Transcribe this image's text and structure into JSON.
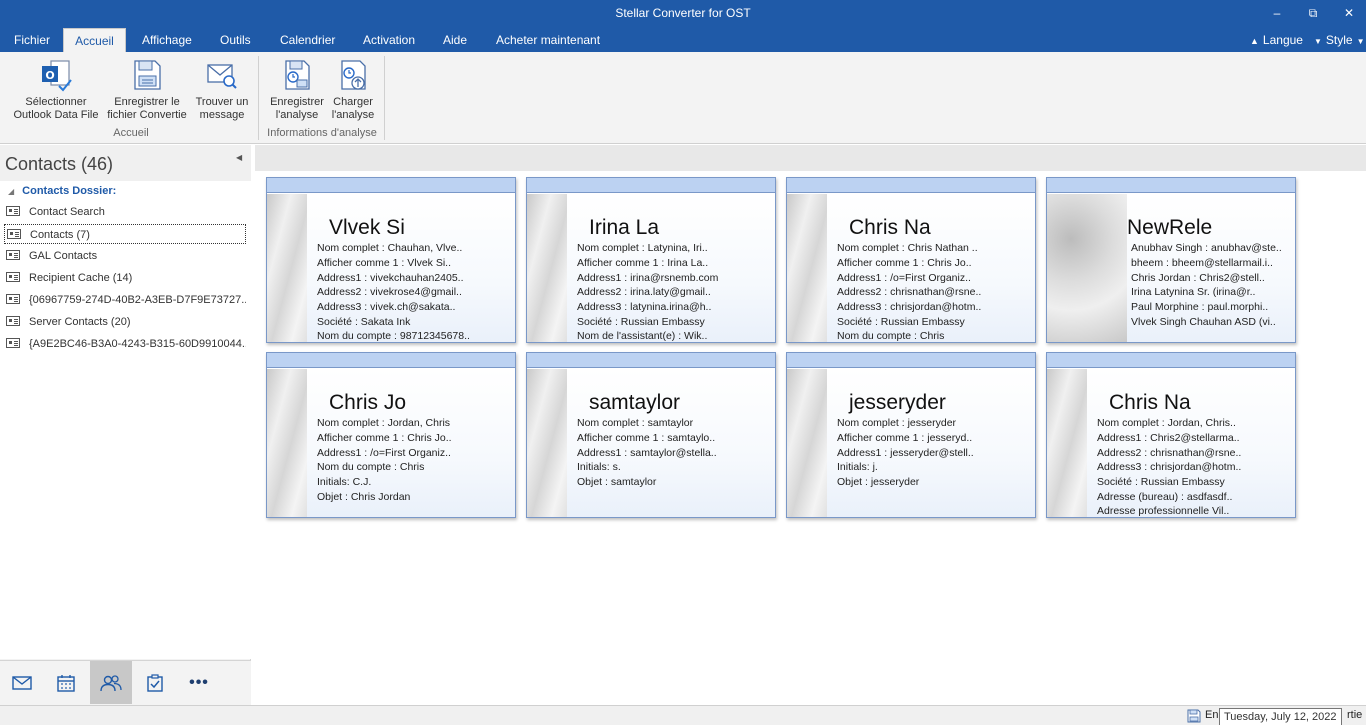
{
  "window": {
    "title": "Stellar Converter for OST",
    "minimize_glyph": "‒",
    "restore_glyph": "⧉",
    "close_glyph": "✕"
  },
  "menu": {
    "items": [
      "Fichier",
      "Accueil",
      "Affichage",
      "Outils",
      "Calendrier",
      "Activation",
      "Aide",
      "Acheter maintenant"
    ],
    "active": "Accueil",
    "langue": "Langue",
    "style": "Style"
  },
  "ribbon": {
    "buttons": [
      {
        "line1": "Sélectionner",
        "line2": "Outlook Data File",
        "icon": "outlook-file-icon"
      },
      {
        "line1": "Enregistrer le",
        "line2": "fichier Convertie",
        "icon": "save-file-icon"
      },
      {
        "line1": "Trouver un",
        "line2": "message",
        "icon": "find-message-icon"
      },
      {
        "line1": "Enregistrer",
        "line2": "l'analyse",
        "icon": "save-scan-icon"
      },
      {
        "line1": "Charger",
        "line2": "l'analyse",
        "icon": "load-scan-icon"
      }
    ],
    "groups": [
      "Accueil",
      "Informations d'analyse"
    ]
  },
  "leftpane": {
    "title": "Contacts (46)",
    "root": "Contacts Dossier:",
    "items": [
      {
        "label": "Contact Search"
      },
      {
        "label": "Contacts (7)"
      },
      {
        "label": "GAL Contacts"
      },
      {
        "label": "Recipient Cache (14)"
      },
      {
        "label": "{06967759-274D-40B2-A3EB-D7F9E73727..."
      },
      {
        "label": "Server Contacts (20)"
      },
      {
        "label": "{A9E2BC46-B3A0-4243-B315-60D9910044..."
      }
    ],
    "selected_index": 1,
    "nav": [
      "mail-icon",
      "calendar-icon",
      "contacts-icon",
      "tasks-icon",
      "more-icon"
    ],
    "nav_active": 2
  },
  "cards": [
    {
      "name": "Vlvek Si",
      "lines": [
        "Nom complet : Chauhan, Vlve..",
        "Afficher comme 1 : Vlvek Si..",
        "Address1 : vivekchauhan2405..",
        "Address2 : vivekrose4@gmail..",
        "Address3 : vivek.ch@sakata..",
        "Société : Sakata Ink",
        "Nom du compte : 98712345678.."
      ]
    },
    {
      "name": "Irina La",
      "lines": [
        "Nom complet : Latynina, Iri..",
        "Afficher comme 1 : Irina La..",
        "Address1 : irina@rsnemb.com",
        "Address2 : irina.laty@gmail..",
        "Address3 : latynina.irina@h..",
        "Société : Russian Embassy",
        "Nom de l'assistant(e) : Wik.."
      ]
    },
    {
      "name": "Chris Na",
      "lines": [
        "Nom complet : Chris Nathan ..",
        "Afficher comme 1 : Chris Jo..",
        "Address1 : /o=First Organiz..",
        "Address2 : chrisnathan@rsne..",
        "Address3 : chrisjordan@hotm..",
        "Société : Russian Embassy",
        "Nom du compte : Chris"
      ]
    },
    {
      "name": "NewRele",
      "wide": true,
      "lines": [
        "Anubhav Singh : anubhav@ste..",
        "bheem : bheem@stellarmail.i..",
        "Chris Jordan : Chris2@stell..",
        "Irina Latynina Sr. (irina@r..",
        "Paul Morphine : paul.morphi..",
        "Vlvek Singh Chauhan ASD (vi.."
      ]
    },
    {
      "name": "Chris Jo",
      "lines": [
        "Nom complet : Jordan, Chris",
        "Afficher comme 1 : Chris Jo..",
        "Address1 : /o=First Organiz..",
        "Nom du compte : Chris",
        "Initials: C.J.",
        "Objet : Chris Jordan"
      ]
    },
    {
      "name": "samtaylor",
      "lines": [
        "Nom complet : samtaylor",
        "Afficher comme 1 : samtaylo..",
        "Address1 : samtaylor@stella..",
        "Initials: s.",
        "Objet : samtaylor"
      ]
    },
    {
      "name": "jesseryder",
      "lines": [
        "Nom complet : jesseryder",
        "Afficher comme 1 : jesseryd..",
        "Address1 : jesseryder@stell..",
        "Initials: j.",
        "Objet : jesseryder"
      ]
    },
    {
      "name": "Chris Na",
      "lines": [
        "Nom complet : Jordan, Chris..",
        "Address1 : Chris2@stellarma..",
        "Address2 : chrisnathan@rsne..",
        "Address3 : chrisjordan@hotm..",
        "Société : Russian Embassy",
        "Adresse (bureau) : asdfasdf..",
        "Adresse professionnelle Vil.."
      ]
    }
  ],
  "status": {
    "left_text": "En",
    "right_text": "rtie",
    "tooltip": "Tuesday, July 12, 2022"
  }
}
